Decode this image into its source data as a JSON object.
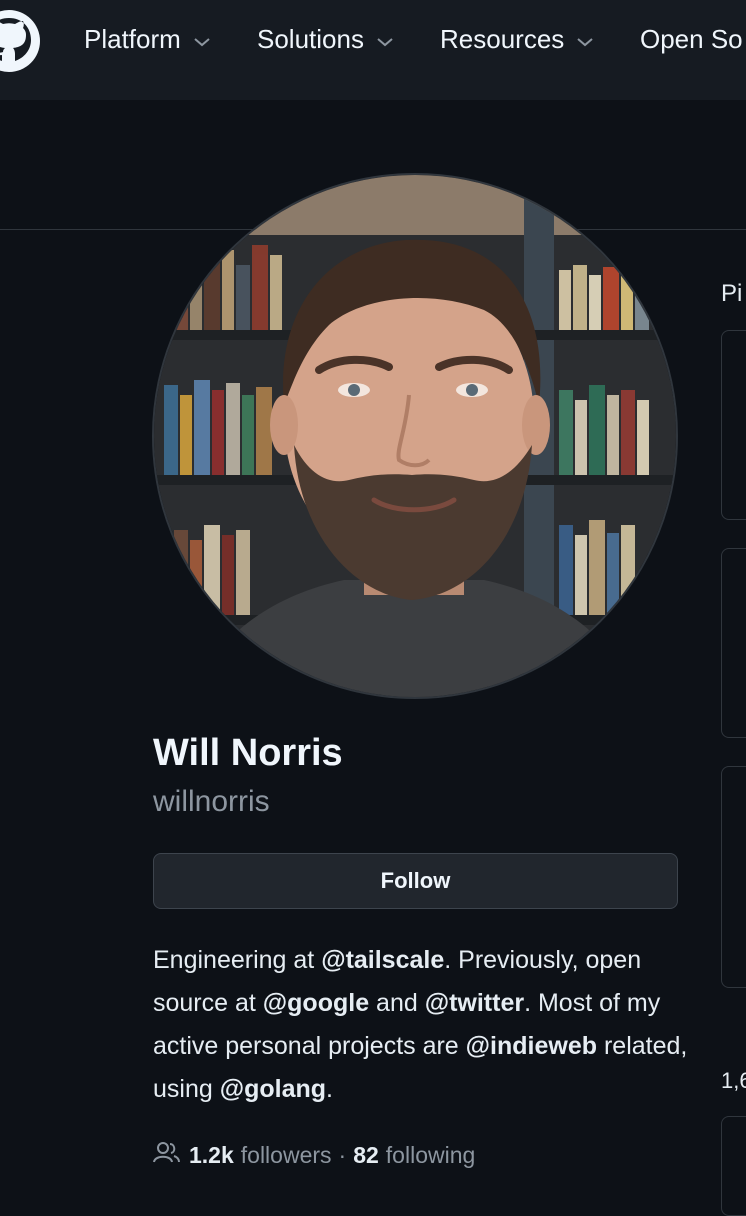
{
  "nav": {
    "items": [
      {
        "label": "Platform"
      },
      {
        "label": "Solutions"
      },
      {
        "label": "Resources"
      },
      {
        "label": "Open So"
      }
    ]
  },
  "profile": {
    "name": "Will Norris",
    "username": "willnorris",
    "follow_label": "Follow",
    "bio": {
      "t1": "Engineering at ",
      "m1": "@tailscale",
      "t2": ". Previously, open source at ",
      "m2": "@google",
      "t3": " and ",
      "m3": "@twitter",
      "t4": ". Most of my active personal projects are ",
      "m4": "@indieweb",
      "t5": " related, using ",
      "m5": "@golang",
      "t6": "."
    },
    "followers_count": "1.2k",
    "followers_label": "followers",
    "separator": "·",
    "following_count": "82",
    "following_label": "following"
  },
  "side": {
    "pinned_label": "Pi",
    "contrib_label": "1,6"
  },
  "icons": {
    "logo": "github-logo-icon",
    "chevron": "chevron-down-icon",
    "people": "people-icon"
  },
  "colors": {
    "background": "#0d1117",
    "header": "#161b22",
    "border": "#30363d",
    "muted": "#8d96a0",
    "text": "#e6edf3"
  }
}
